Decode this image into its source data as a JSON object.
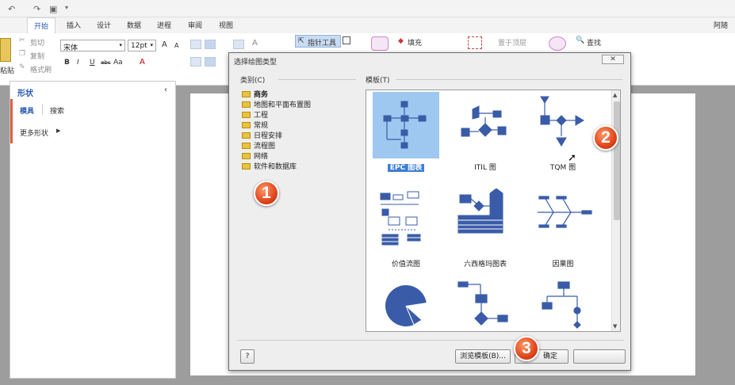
{
  "app": {
    "user_name_truncated": "阿随"
  },
  "ribbon_tabs": [
    "开始",
    "插入",
    "设计",
    "数据",
    "进程",
    "审阅",
    "视图"
  ],
  "active_tab": "开始",
  "clipboard": {
    "paste": "粘贴",
    "cut": "剪切",
    "copy": "复制",
    "format_painter": "格式刷"
  },
  "font": {
    "name": "宋体",
    "size": "12pt",
    "bold": "B",
    "italic": "I",
    "underline": "U",
    "strike": "abc",
    "case": "Aa",
    "color": "A",
    "grow": "A",
    "shrink": "A"
  },
  "tools": {
    "pointer": "指针工具",
    "fill": "填充",
    "bring_to_front": "置于顶层",
    "find": "查找"
  },
  "shapes_pane": {
    "title": "形状",
    "tab_stencils": "模具",
    "tab_search": "搜索",
    "more_shapes": "更多形状"
  },
  "dialog": {
    "title": "选择绘图类型",
    "close": "✕",
    "category_label": "类别(C)",
    "template_label": "模板(T)",
    "categories": [
      "商务",
      "地图和平面布置图",
      "工程",
      "常规",
      "日程安排",
      "流程图",
      "网络",
      "软件和数据库"
    ],
    "selected_category": "商务",
    "templates": [
      {
        "label": "EPC 图表",
        "selected": true
      },
      {
        "label": "ITIL 图",
        "selected": false
      },
      {
        "label": "TQM 图",
        "selected": false
      },
      {
        "label": "价值流图",
        "selected": false
      },
      {
        "label": "六西格玛图表",
        "selected": false
      },
      {
        "label": "因果图",
        "selected": false
      },
      {
        "label": "",
        "selected": false
      },
      {
        "label": "",
        "selected": false
      },
      {
        "label": "",
        "selected": false
      }
    ],
    "help_icon": "?",
    "browse_button": "浏览模板(B)...",
    "ok_button": "确定"
  },
  "callouts": [
    "1",
    "2",
    "3"
  ],
  "colors": {
    "accent": "#2a5db0",
    "shape_blue": "#3a5ca8",
    "selection": "#9ec8f0",
    "badge": "#e0441a"
  }
}
